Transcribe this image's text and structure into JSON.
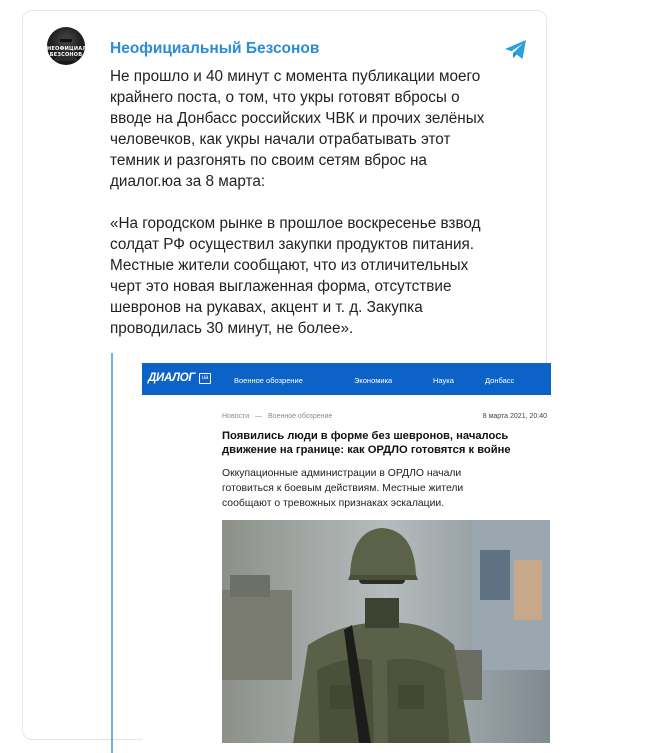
{
  "channel": {
    "name": "Неофициальный Безсонов",
    "avatar_text": "НЕОФИЦИАЛЬНЫЙ БЕЗСОНОВ"
  },
  "post": {
    "paragraph1": "Не прошло и 40 минут с момента публикации моего\nкрайнего поста, о том, что укры готовят вбросы о\nвводе на Донбасс российских ЧВК и прочих зелёных\nчеловечков, как укры начали отрабатывать этот\nтемник и разгонять по своим сетям вброс на\nдиалог.юа за 8 марта:",
    "paragraph2": "«На городском рынке в прошлое воскресенье взвод\nсолдат РФ осуществил закупки продуктов питания.\nМестные жители сообщают, что из отличительных\nчерт это новая выглаженная форма, отсутствие\nшевронов на рукавах, акцент и т. д. Закупка\nпроводилась 30 минут, не более»."
  },
  "screenshot": {
    "logo": "ДИАЛОГ",
    "logo_badge": "ua",
    "nav": [
      "Военное обозрение",
      "Экономика",
      "Наука",
      "Донбасс"
    ],
    "breadcrumb": [
      "Новости",
      "—",
      "Военное обозрение"
    ],
    "date": "8 марта 2021, 20:40",
    "title": "Появились люди в форме без шевронов, началось\nдвижение на границе: как ОРДЛО готовятся к войне",
    "lead": "Оккупационные администрации в ОРДЛО начали\nготовиться к боевым действиям. Местные жители\nсообщают о тревожных признаках эскалации."
  },
  "colors": {
    "channel_name": "#2b8cd6",
    "quote_bar": "#6fb0e5",
    "site_nav": "#0d62c7",
    "telegram": "#2aa1da"
  },
  "icons": {
    "telegram": "telegram-plane-icon",
    "photo": "soldier-photo"
  }
}
